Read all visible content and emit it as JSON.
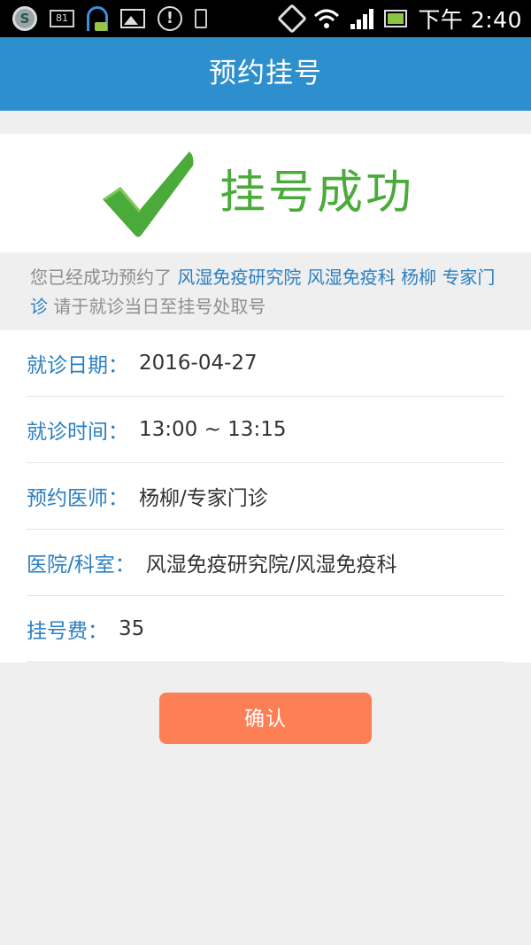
{
  "status_bar": {
    "time": "下午 2:40",
    "notification_badge": "81",
    "left_icons": [
      "security-app-icon",
      "badge-81-icon",
      "headset-icon",
      "image-icon",
      "alert-icon",
      "phone-icon"
    ],
    "right_icons": [
      "vibrate-icon",
      "wifi-icon",
      "signal-icon",
      "battery-icon"
    ]
  },
  "header": {
    "title": "预约挂号"
  },
  "success": {
    "title": "挂号成功",
    "icon": "check-icon",
    "icon_color": "#4aab3a"
  },
  "notice": {
    "prefix": "您已经成功预约了",
    "hospital": "风湿免疫研究院",
    "department": "风湿免疫科",
    "doctor": "杨柳",
    "clinic_type": "专家门诊",
    "suffix": "请于就诊当日至挂号处取号"
  },
  "details": {
    "rows": [
      {
        "label": "就诊日期：",
        "value": "2016-04-27"
      },
      {
        "label": "就诊时间：",
        "value": "13:00 ~ 13:15"
      },
      {
        "label": "预约医师：",
        "value": "杨柳/专家门诊"
      },
      {
        "label": "医院/科室：",
        "value": "风湿免疫研究院/风湿免疫科"
      },
      {
        "label": "挂号费：",
        "value": "35"
      }
    ]
  },
  "actions": {
    "confirm_label": "确认"
  },
  "colors": {
    "header_bg": "#2d8fcd",
    "accent_blue": "#2b7fc0",
    "success_green": "#4aab3a",
    "button_orange": "#fd7f55"
  }
}
